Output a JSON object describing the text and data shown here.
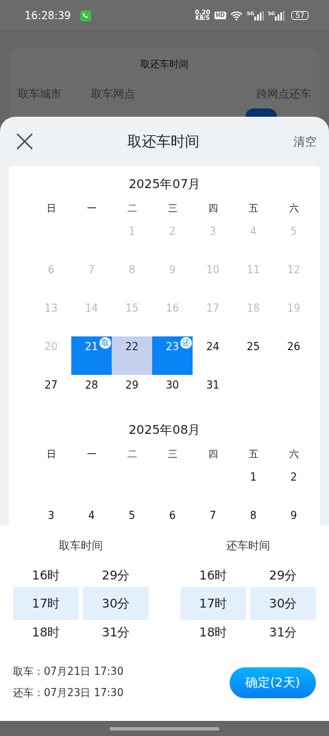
{
  "status_bar": {
    "time": "16:28:39",
    "net_speed": "0.20",
    "net_unit": "KB/S",
    "hd": "HD",
    "signals": [
      "5G",
      "5G"
    ],
    "battery": "57"
  },
  "background_page": {
    "title": "取还车时间",
    "labels": [
      "取车城市",
      "取车网点",
      "跨网点还车"
    ],
    "toggle": {
      "on": true
    }
  },
  "sheet": {
    "title": "取还车时间",
    "clear": "清空"
  },
  "months": [
    {
      "title": "2025年07月",
      "weekdays": [
        "日",
        "一",
        "二",
        "三",
        "四",
        "五",
        "六"
      ],
      "weeks": [
        [
          {
            "kind": "blank"
          },
          {
            "kind": "blank"
          },
          {
            "kind": "disabled",
            "text": "1"
          },
          {
            "kind": "disabled",
            "text": "2"
          },
          {
            "kind": "disabled",
            "text": "3"
          },
          {
            "kind": "disabled",
            "text": "4"
          },
          {
            "kind": "disabled",
            "text": "5"
          }
        ],
        [
          {
            "kind": "disabled",
            "text": "6"
          },
          {
            "kind": "disabled",
            "text": "7"
          },
          {
            "kind": "disabled",
            "text": "8"
          },
          {
            "kind": "disabled",
            "text": "9"
          },
          {
            "kind": "disabled",
            "text": "10"
          },
          {
            "kind": "disabled",
            "text": "11"
          },
          {
            "kind": "disabled",
            "text": "12"
          }
        ],
        [
          {
            "kind": "disabled",
            "text": "13"
          },
          {
            "kind": "disabled",
            "text": "14"
          },
          {
            "kind": "disabled",
            "text": "15"
          },
          {
            "kind": "disabled",
            "text": "16"
          },
          {
            "kind": "disabled",
            "text": "17"
          },
          {
            "kind": "disabled",
            "text": "18"
          },
          {
            "kind": "disabled",
            "text": "19"
          }
        ],
        [
          {
            "kind": "disabled",
            "text": "20"
          },
          {
            "kind": "start",
            "text": "21",
            "badge": "取"
          },
          {
            "kind": "range",
            "text": "22"
          },
          {
            "kind": "end",
            "text": "23",
            "badge": "还"
          },
          {
            "kind": "normal",
            "text": "24"
          },
          {
            "kind": "normal",
            "text": "25"
          },
          {
            "kind": "normal",
            "text": "26"
          }
        ],
        [
          {
            "kind": "normal",
            "text": "27"
          },
          {
            "kind": "normal",
            "text": "28"
          },
          {
            "kind": "normal",
            "text": "29"
          },
          {
            "kind": "normal",
            "text": "30"
          },
          {
            "kind": "normal",
            "text": "31"
          }
        ]
      ]
    },
    {
      "title": "2025年08月",
      "weekdays": [
        "日",
        "一",
        "二",
        "三",
        "四",
        "五",
        "六"
      ],
      "weeks": [
        [
          {
            "kind": "blank"
          },
          {
            "kind": "blank"
          },
          {
            "kind": "blank"
          },
          {
            "kind": "blank"
          },
          {
            "kind": "blank"
          },
          {
            "kind": "normal",
            "text": "1"
          },
          {
            "kind": "normal",
            "text": "2"
          }
        ],
        [
          {
            "kind": "normal",
            "text": "3"
          },
          {
            "kind": "normal",
            "text": "4"
          },
          {
            "kind": "normal",
            "text": "5"
          },
          {
            "kind": "normal",
            "text": "6"
          },
          {
            "kind": "normal",
            "text": "7"
          },
          {
            "kind": "normal",
            "text": "8"
          },
          {
            "kind": "normal",
            "text": "9"
          }
        ]
      ]
    }
  ],
  "pickers": [
    {
      "title": "取车时间",
      "columns": [
        [
          {
            "text": "16时",
            "selected": false
          },
          {
            "text": "17时",
            "selected": true
          },
          {
            "text": "18时",
            "selected": false
          }
        ],
        [
          {
            "text": "29分",
            "selected": false
          },
          {
            "text": "30分",
            "selected": true
          },
          {
            "text": "31分",
            "selected": false
          }
        ]
      ]
    },
    {
      "title": "还车时间",
      "columns": [
        [
          {
            "text": "16时",
            "selected": false
          },
          {
            "text": "17时",
            "selected": true
          },
          {
            "text": "18时",
            "selected": false
          }
        ],
        [
          {
            "text": "29分",
            "selected": false
          },
          {
            "text": "30分",
            "selected": true
          },
          {
            "text": "31分",
            "selected": false
          }
        ]
      ]
    }
  ],
  "summary": [
    "取车：07月21日 17:30",
    "还车：07月23日 17:30"
  ],
  "confirm": "确定(2天)"
}
